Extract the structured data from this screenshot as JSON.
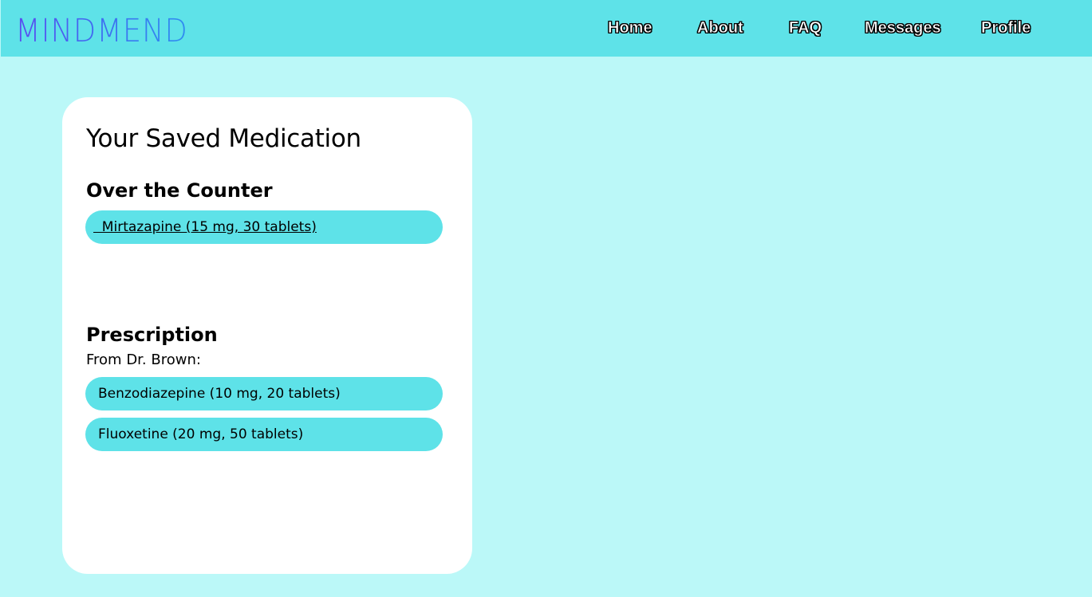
{
  "header": {
    "logo": "MINDMEND",
    "nav": {
      "home": "Home",
      "about": "About",
      "faq": "FAQ",
      "messages": "Messages",
      "profile": "Profile"
    }
  },
  "card": {
    "title": "Your Saved Medication",
    "otc": {
      "heading": "Over the Counter",
      "items": [
        "  Mirtazapine (15 mg, 30 tablets)"
      ]
    },
    "prescription": {
      "heading": "Prescription",
      "from_label": "From Dr. Brown:",
      "items": [
        "Benzodiazepine (10 mg, 20 tablets)",
        "Fluoxetine (20 mg, 50 tablets)"
      ]
    }
  },
  "colors": {
    "page_bg": "#bbf8f8",
    "header_bg": "#5ee2e8",
    "pill_bg": "#5ee2e8",
    "card_bg": "#ffffff",
    "logo_gradient_start": "#5b4cf0",
    "logo_gradient_end": "#2f8ef0"
  }
}
